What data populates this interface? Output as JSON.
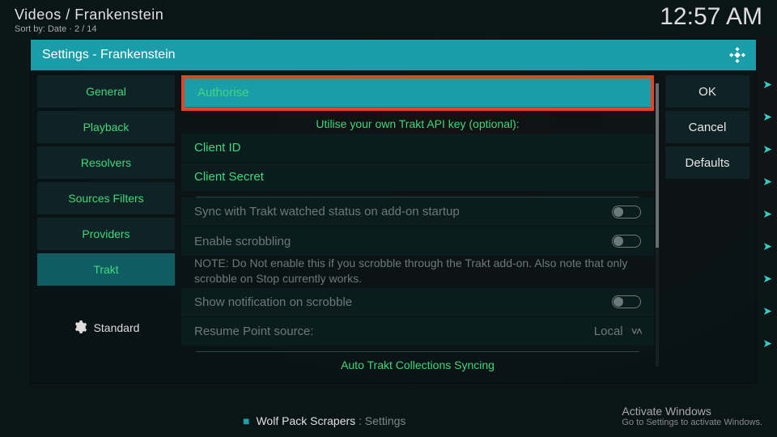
{
  "topbar": {
    "breadcrumb": "Videos / Frankenstein",
    "sort": "Sort by: Date  ·  2 / 14",
    "clock": "12:57 AM"
  },
  "modal": {
    "title": "Settings - Frankenstein"
  },
  "cats": {
    "items": [
      {
        "label": "General"
      },
      {
        "label": "Playback"
      },
      {
        "label": "Resolvers"
      },
      {
        "label": "Sources Filters"
      },
      {
        "label": "Providers"
      },
      {
        "label": "Trakt"
      }
    ],
    "expert_label": "Standard"
  },
  "settings": {
    "authorise": "Authorise",
    "section1": "Utilise your own Trakt API key (optional):",
    "client_id": "Client ID",
    "client_secret": "Client Secret",
    "sync_label": "Sync with Trakt watched status on add-on startup",
    "scrobble_label": "Enable scrobbling",
    "note": "NOTE: Do Not enable this if you scrobble through the Trakt add-on. Also note that only scrobble on Stop currently works.",
    "notif_label": "Show notification on scrobble",
    "resume_label": "Resume Point source:",
    "resume_value": "Local",
    "section2": "Auto Trakt Collections Syncing"
  },
  "actions": {
    "ok": "OK",
    "cancel": "Cancel",
    "defaults": "Defaults"
  },
  "bg": {
    "line1_a": "Wolf Pack Scrapers",
    "line1_b": " : Settings"
  },
  "watermark": {
    "title": "Activate Windows",
    "sub": "Go to Settings to activate Windows."
  }
}
